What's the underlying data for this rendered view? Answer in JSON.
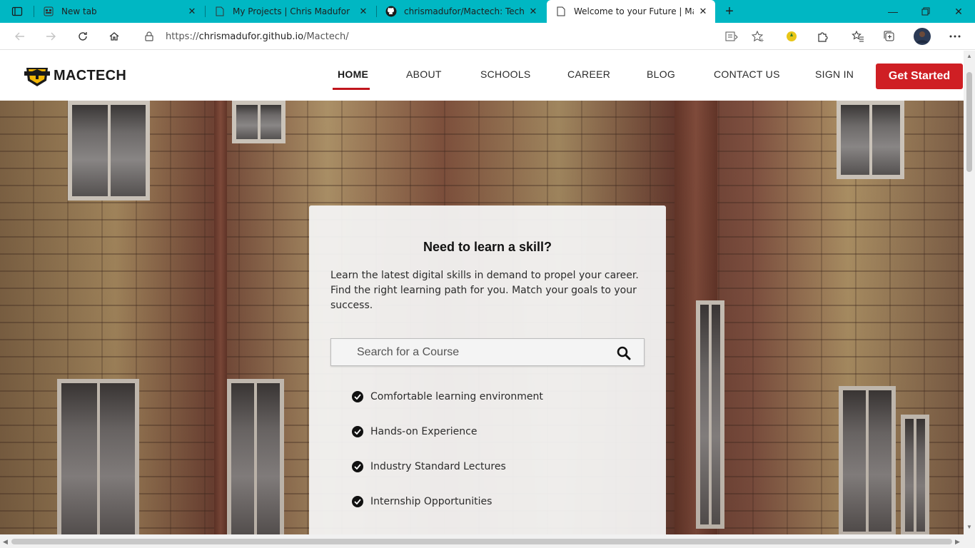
{
  "browser": {
    "tabs": [
      {
        "title": "New tab",
        "icon": "new-tab-page-icon"
      },
      {
        "title": "My Projects | Chris Madufor",
        "icon": "page-icon"
      },
      {
        "title": "chrismadufor/Mactech: Techacad",
        "icon": "github-icon"
      },
      {
        "title": "Welcome to your Future | Mactec",
        "icon": "page-icon",
        "active": true
      }
    ],
    "url": {
      "prefix": "https://",
      "host": "chrismadufor.github.io",
      "path": "/Mactech/"
    },
    "accent_color": "#00b7c3"
  },
  "site": {
    "brand": "MACTECH",
    "nav": [
      {
        "label": "HOME",
        "active": true
      },
      {
        "label": "ABOUT"
      },
      {
        "label": "SCHOOLS"
      },
      {
        "label": "CAREER"
      },
      {
        "label": "BLOG"
      },
      {
        "label": "CONTACT US"
      },
      {
        "label": "SIGN IN"
      }
    ],
    "cta_label": "Get Started",
    "brand_color": "#cf1f24"
  },
  "hero_card": {
    "title": "Need to learn a skill?",
    "description": "Learn the latest digital skills in demand to propel your career. Find the right learning path for you. Match your goals to your success.",
    "search_placeholder": "Search for a Course",
    "features": [
      "Comfortable learning environment",
      "Hands-on Experience",
      "Industry Standard Lectures",
      "Internship Opportunities"
    ]
  }
}
